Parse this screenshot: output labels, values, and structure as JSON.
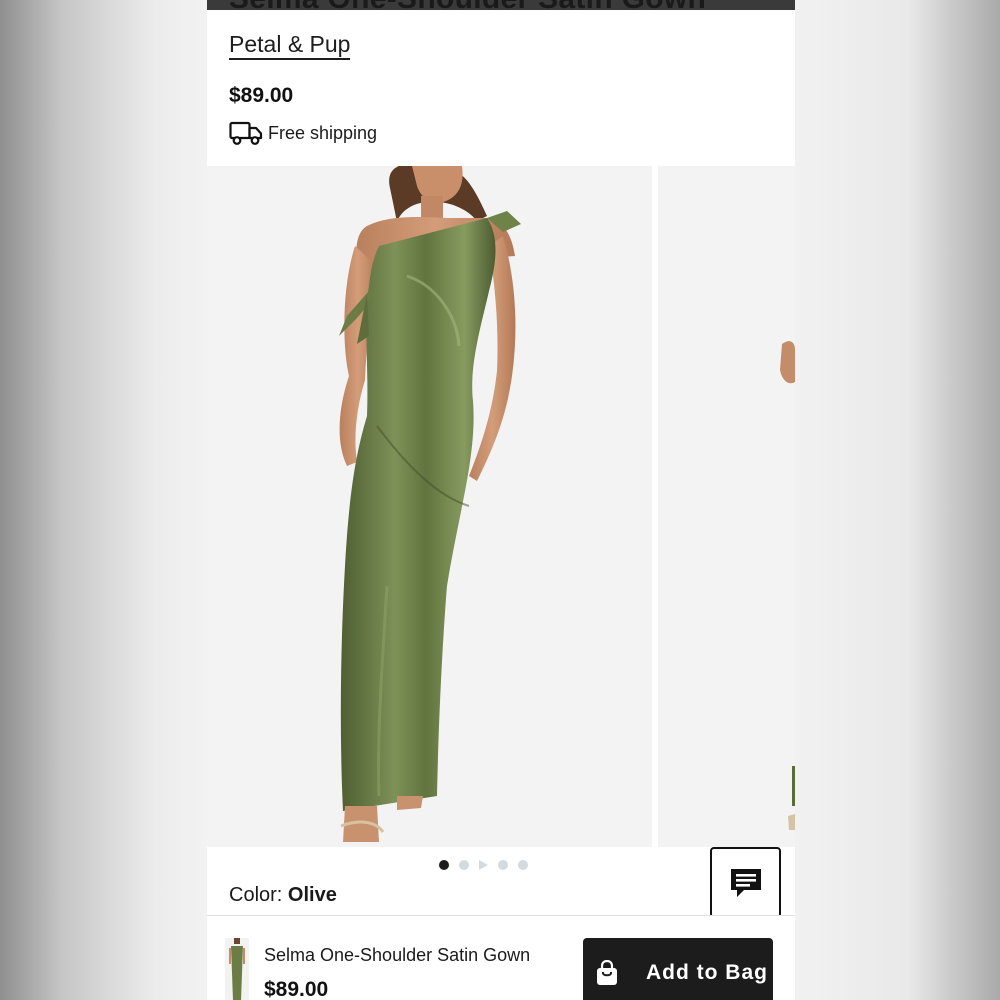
{
  "product": {
    "title": "Selma One-Shoulder Satin Gown",
    "brand": "Petal & Pup",
    "price": "$89.00",
    "shipping_label": "Free shipping"
  },
  "gallery": {
    "slide_count": 5,
    "active_index": 0
  },
  "color": {
    "label": "Color:",
    "value": "Olive"
  },
  "bottom_bar": {
    "name": "Selma One-Shoulder Satin Gown",
    "price": "$89.00",
    "add_label": "Add to Bag"
  },
  "colors": {
    "dress": "#6b7d45",
    "button": "#1c1c1c"
  },
  "icons": [
    "truck-icon",
    "chat-icon",
    "shopping-bag-icon",
    "play-icon"
  ]
}
